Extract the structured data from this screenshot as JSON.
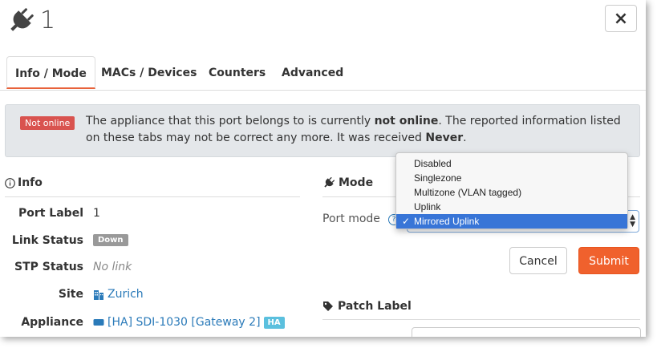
{
  "header": {
    "port_number": "1",
    "close_label": "×",
    "plug_icon": "plug-icon"
  },
  "tabs": [
    {
      "label": "Info / Mode",
      "active": true
    },
    {
      "label": "MACs / Devices",
      "active": false
    },
    {
      "label": "Counters",
      "active": false
    },
    {
      "label": "Advanced",
      "active": false
    }
  ],
  "alert": {
    "badge": "Not online",
    "text_1": "The appliance that this port belongs to is currently ",
    "bold_1": "not online",
    "text_2": ". The reported information listed on these tabs may not be correct any more. It was received ",
    "bold_2": "Never",
    "text_3": "."
  },
  "info": {
    "title": "Info",
    "rows": [
      {
        "label": "Port Label",
        "value": "1"
      },
      {
        "label": "Link Status",
        "value": "Down"
      },
      {
        "label": "STP Status",
        "value": "No link"
      },
      {
        "label": "Site",
        "value": "Zurich"
      },
      {
        "label": "Appliance",
        "value": "[HA] SDI-1030 [Gateway 2]",
        "badge": "HA"
      }
    ]
  },
  "mode": {
    "title": "Mode",
    "port_mode_label": "Port mode",
    "help": "?",
    "options": [
      "Disabled",
      "Singlezone",
      "Multizone (VLAN tagged)",
      "Uplink",
      "Mirrored Uplink"
    ],
    "selected": "Mirrored Uplink",
    "cancel_label": "Cancel",
    "submit_label": "Submit"
  },
  "patch": {
    "title": "Patch Label"
  },
  "colors": {
    "accent": "#f0612d",
    "danger": "#d9534f",
    "link": "#2a7ab9",
    "select_highlight": "#3875d7"
  }
}
